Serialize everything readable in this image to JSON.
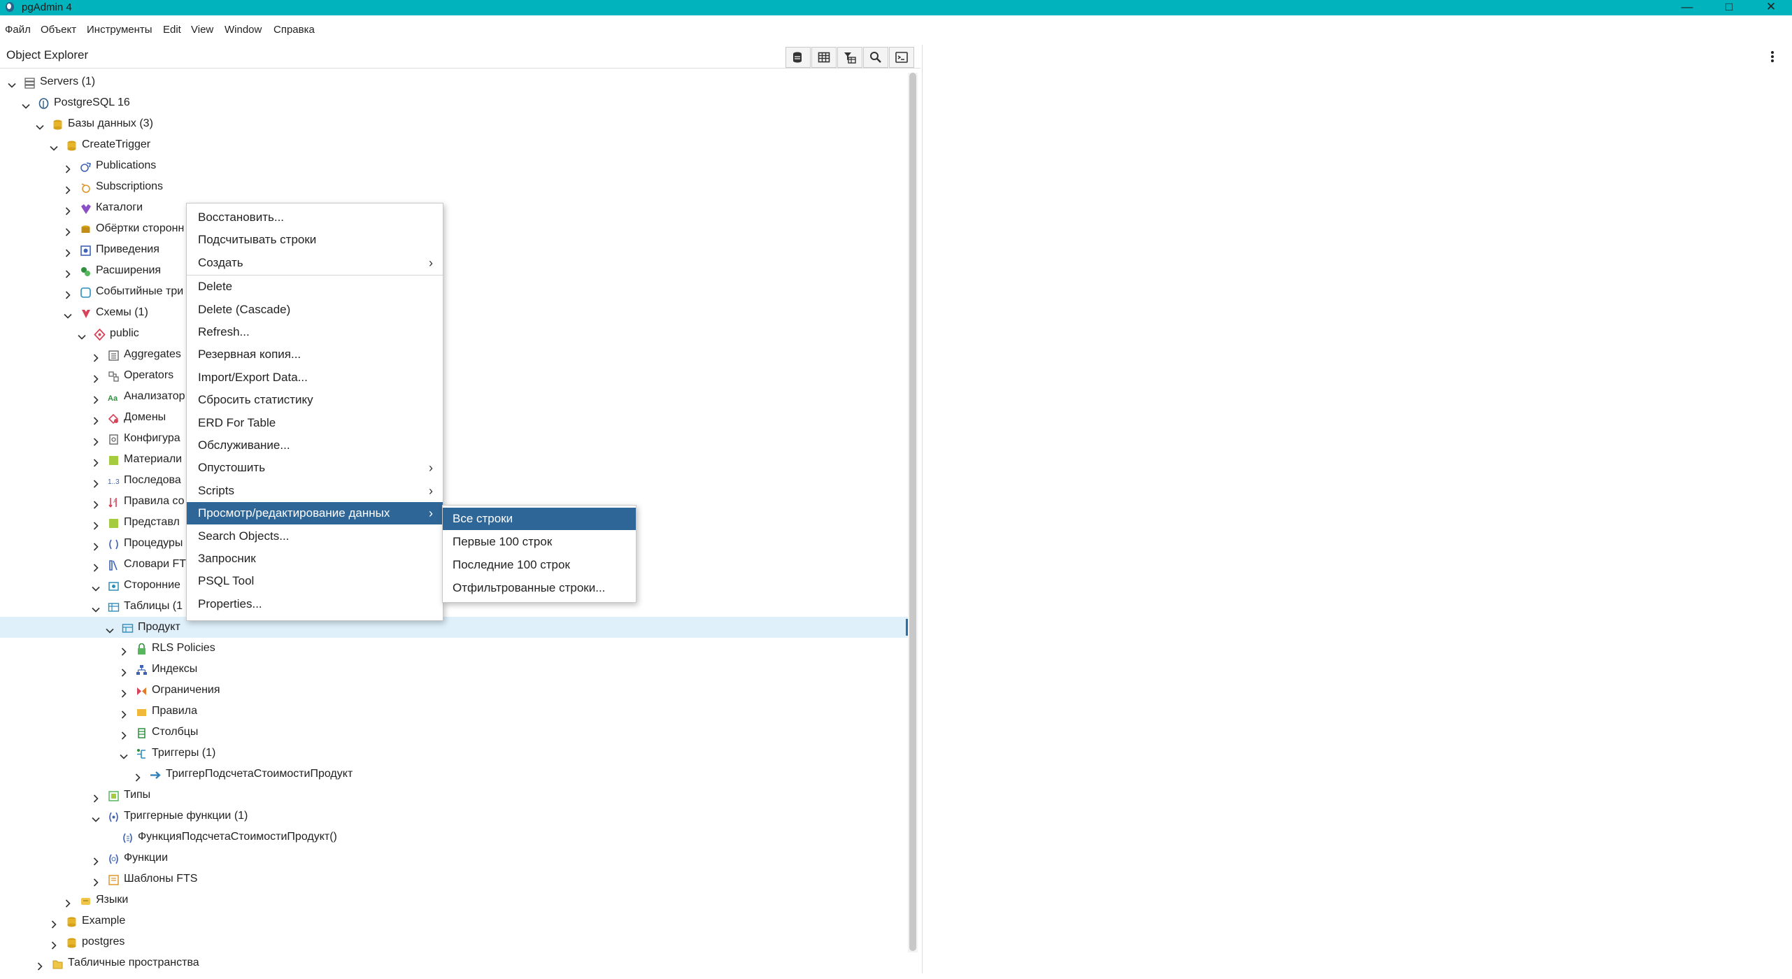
{
  "window": {
    "title": "pgAdmin 4"
  },
  "menubar": [
    "Файл",
    "Объект",
    "Инструменты",
    "Edit",
    "View",
    "Window",
    "Справка"
  ],
  "object_explorer": {
    "title": "Object Explorer",
    "toolbar_icons": [
      "query-tool-icon",
      "table-view-icon",
      "filter-table-icon",
      "search-icon",
      "psql-terminal-icon"
    ]
  },
  "tree": [
    {
      "label": "Servers (1)",
      "icon": "servers-icon",
      "expanded": true,
      "level": 0
    },
    {
      "label": "PostgreSQL 16",
      "icon": "postgresql-icon",
      "expanded": true,
      "level": 1
    },
    {
      "label": "Базы данных (3)",
      "icon": "databases-icon",
      "expanded": true,
      "level": 2
    },
    {
      "label": "CreateTrigger",
      "icon": "database-icon",
      "expanded": true,
      "level": 3
    },
    {
      "label": "Publications",
      "icon": "publications-icon",
      "expanded": false,
      "level": 4
    },
    {
      "label": "Subscriptions",
      "icon": "subscriptions-icon",
      "expanded": false,
      "level": 4
    },
    {
      "label": "Каталоги",
      "icon": "catalogs-icon",
      "expanded": false,
      "level": 4
    },
    {
      "label": "Обёртки сторонн",
      "icon": "fdw-icon",
      "expanded": false,
      "level": 4
    },
    {
      "label": "Приведения",
      "icon": "casts-icon",
      "expanded": false,
      "level": 4
    },
    {
      "label": "Расширения",
      "icon": "extensions-icon",
      "expanded": false,
      "level": 4
    },
    {
      "label": "Событийные три",
      "icon": "event-triggers-icon",
      "expanded": false,
      "level": 4
    },
    {
      "label": "Схемы (1)",
      "icon": "schemas-icon",
      "expanded": true,
      "level": 4
    },
    {
      "label": "public",
      "icon": "schema-icon",
      "expanded": true,
      "level": 5
    },
    {
      "label": "Aggregates",
      "icon": "aggregates-icon",
      "expanded": false,
      "level": 6
    },
    {
      "label": "Operators",
      "icon": "operators-icon",
      "expanded": false,
      "level": 6
    },
    {
      "label": "Анализатор",
      "icon": "fts-parser-icon",
      "expanded": false,
      "level": 6
    },
    {
      "label": "Домены",
      "icon": "domains-icon",
      "expanded": false,
      "level": 6
    },
    {
      "label": "Конфигура",
      "icon": "fts-config-icon",
      "expanded": false,
      "level": 6
    },
    {
      "label": "Материали",
      "icon": "mview-icon",
      "expanded": false,
      "level": 6
    },
    {
      "label": "Последова",
      "icon": "sequences-icon",
      "expanded": false,
      "level": 6
    },
    {
      "label": "Правила со",
      "icon": "collations-icon",
      "expanded": false,
      "level": 6
    },
    {
      "label": "Представл",
      "icon": "views-icon",
      "expanded": false,
      "level": 6
    },
    {
      "label": "Процедуры",
      "icon": "procedures-icon",
      "expanded": false,
      "level": 6
    },
    {
      "label": "Словари FT",
      "icon": "fts-dictionaries-icon",
      "expanded": false,
      "level": 6
    },
    {
      "label": "Сторонние",
      "icon": "foreign-tables-icon",
      "expanded": true,
      "level": 6
    },
    {
      "label": "Таблицы (1",
      "icon": "tables-icon",
      "expanded": true,
      "level": 6
    },
    {
      "label": "Продукт",
      "icon": "table-icon",
      "expanded": true,
      "level": 7,
      "selected": true
    },
    {
      "label": "RLS Policies",
      "icon": "rls-policy-icon",
      "expanded": false,
      "level": 8
    },
    {
      "label": "Индексы",
      "icon": "indexes-icon",
      "expanded": false,
      "level": 8
    },
    {
      "label": "Ограничения",
      "icon": "constraints-icon",
      "expanded": false,
      "level": 8
    },
    {
      "label": "Правила",
      "icon": "rules-icon",
      "expanded": false,
      "level": 8
    },
    {
      "label": "Столбцы",
      "icon": "columns-icon",
      "expanded": false,
      "level": 8
    },
    {
      "label": "Триггеры (1)",
      "icon": "triggers-icon",
      "expanded": true,
      "level": 8
    },
    {
      "label": "ТриггерПодсчетаСтоимостиПродукт",
      "icon": "trigger-icon",
      "expanded": false,
      "level": 9
    },
    {
      "label": "Типы",
      "icon": "types-icon",
      "expanded": false,
      "level": 6
    },
    {
      "label": "Триггерные функции (1)",
      "icon": "trigger-functions-icon",
      "expanded": true,
      "level": 6
    },
    {
      "label": "ФункцияПодсчетаСтоимостиПродукт()",
      "icon": "trigger-function-icon",
      "expanded": null,
      "level": 7
    },
    {
      "label": "Функции",
      "icon": "functions-icon",
      "expanded": false,
      "level": 6
    },
    {
      "label": "Шаблоны FTS",
      "icon": "fts-templates-icon",
      "expanded": false,
      "level": 6
    },
    {
      "label": "Языки",
      "icon": "languages-icon",
      "expanded": false,
      "level": 4
    },
    {
      "label": "Example",
      "icon": "database-icon",
      "expanded": false,
      "level": 3
    },
    {
      "label": "postgres",
      "icon": "database-icon",
      "expanded": false,
      "level": 3
    },
    {
      "label": "Табличные пространства",
      "icon": "tablespaces-icon",
      "expanded": false,
      "level": 2
    }
  ],
  "context_menu": [
    {
      "label": "Восстановить...",
      "submenu": false
    },
    {
      "label": "Подсчитывать строки",
      "submenu": false
    },
    {
      "label": "Создать",
      "submenu": true
    },
    {
      "separator": true
    },
    {
      "label": "Delete",
      "submenu": false
    },
    {
      "label": "Delete (Cascade)",
      "submenu": false
    },
    {
      "label": "Refresh...",
      "submenu": false
    },
    {
      "label": "Резервная копия...",
      "submenu": false
    },
    {
      "label": "Import/Export Data...",
      "submenu": false
    },
    {
      "label": "Сбросить статистику",
      "submenu": false
    },
    {
      "label": "ERD For Table",
      "submenu": false
    },
    {
      "label": "Обслуживание...",
      "submenu": false
    },
    {
      "label": "Опустошить",
      "submenu": true
    },
    {
      "label": "Scripts",
      "submenu": true
    },
    {
      "label": "Просмотр/редактирование данных",
      "submenu": true,
      "highlight": true
    },
    {
      "label": "Search Objects...",
      "submenu": false
    },
    {
      "label": "Запросник",
      "submenu": false
    },
    {
      "label": "PSQL Tool",
      "submenu": false
    },
    {
      "label": "Properties...",
      "submenu": false
    }
  ],
  "submenu": [
    {
      "label": "Все строки",
      "highlight": true
    },
    {
      "label": "Первые 100 строк"
    },
    {
      "label": "Последние 100 строк"
    },
    {
      "label": "Отфильтрованные строки..."
    }
  ],
  "colors": {
    "titlebar": "#00b3bd",
    "selected_row": "#dff0fb",
    "menu_highlight": "#2f6698"
  }
}
